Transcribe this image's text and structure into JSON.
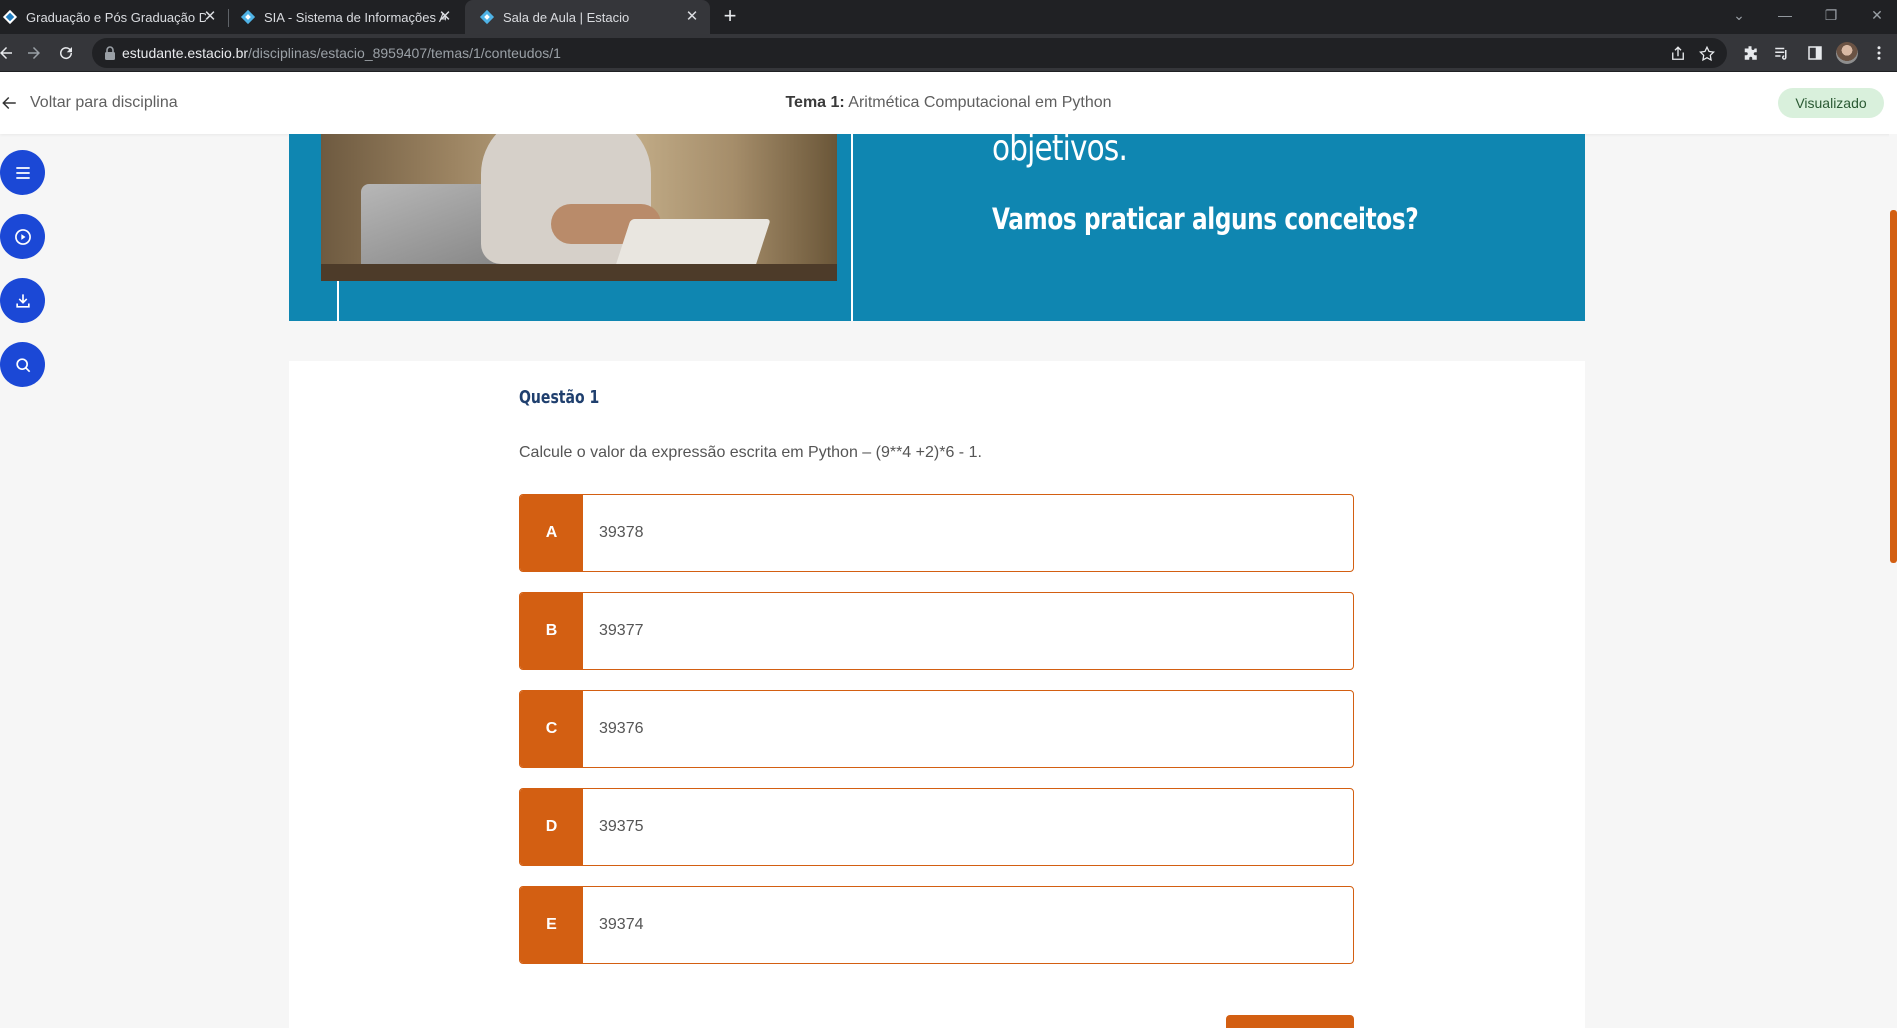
{
  "browser": {
    "tabs": [
      {
        "title": "Graduação e Pós Graduação Digital",
        "active": false
      },
      {
        "title": "SIA - Sistema de Informações Acadêmicas",
        "active": false
      },
      {
        "title": "Sala de Aula | Estacio",
        "active": true
      }
    ],
    "new_tab_label": "+",
    "url": {
      "host": "estudante.estacio.br",
      "path": "/disciplinas/estacio_8959407/temas/1/conteudos/1"
    },
    "icons": [
      "back-arrow-icon",
      "forward-arrow-icon",
      "reload-icon",
      "lock-icon",
      "share-icon",
      "star-icon",
      "extensions-icon",
      "reading-list-icon",
      "side-panel-icon",
      "profile-avatar",
      "more-menu-icon"
    ]
  },
  "header": {
    "back_label": "Voltar para disciplina",
    "tema_prefix": "Tema 1:",
    "tema_name": "Aritmética Computacional em Python",
    "status": "Visualizado"
  },
  "side_nav": [
    "menu-icon",
    "play-icon",
    "download-icon",
    "search-icon"
  ],
  "banner": {
    "line1": "objetivos.",
    "line2": "Vamos praticar alguns conceitos?"
  },
  "question": {
    "title": "Questão 1",
    "text": "Calcule o valor da expressão escrita em Python – (9**4 +2)*6 - 1.",
    "options": [
      {
        "letter": "A",
        "value": "39378"
      },
      {
        "letter": "B",
        "value": "39377"
      },
      {
        "letter": "C",
        "value": "39376"
      },
      {
        "letter": "D",
        "value": "39375"
      },
      {
        "letter": "E",
        "value": "39374"
      }
    ]
  },
  "colors": {
    "accent": "#d35f12",
    "banner": "#0f86b1",
    "nav_button": "#1b48d6",
    "badge_bg": "#d9f0dc",
    "title": "#1f3f6e"
  }
}
